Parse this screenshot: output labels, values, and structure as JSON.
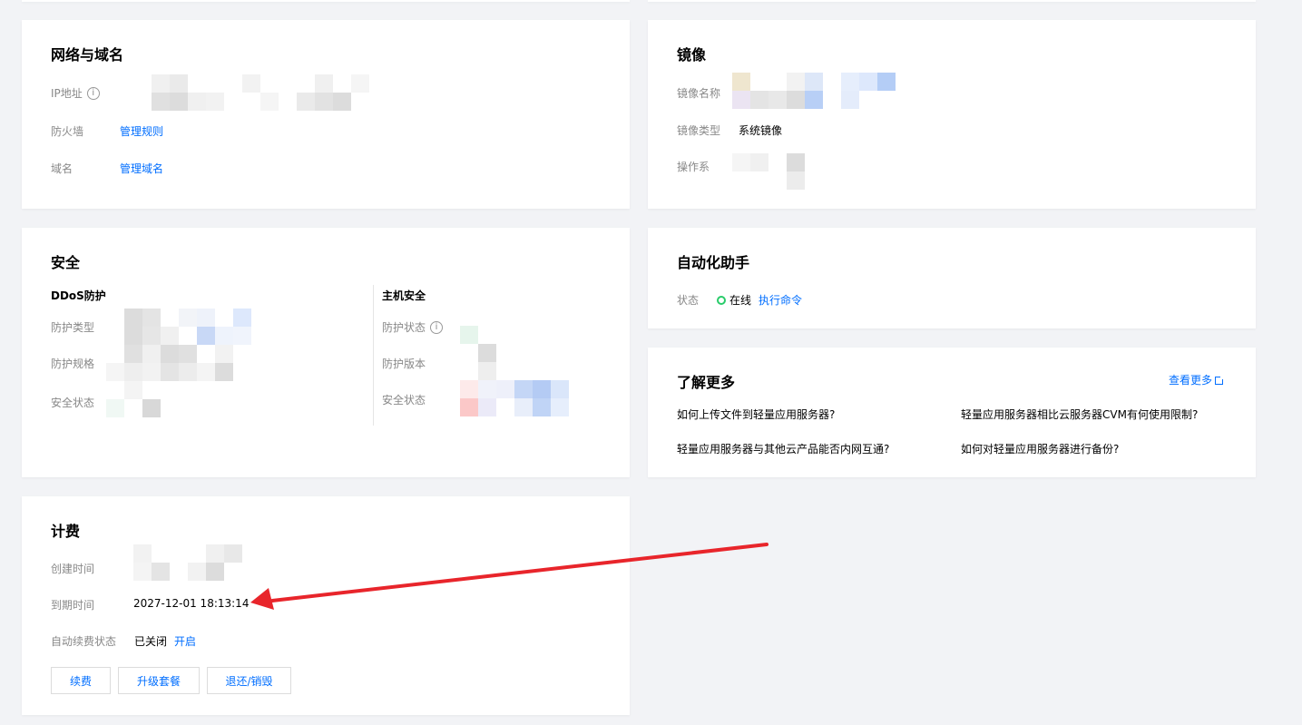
{
  "network": {
    "title": "网络与域名",
    "ip_label": "IP地址",
    "firewall_label": "防火墙",
    "firewall_link": "管理规则",
    "domain_label": "域名",
    "domain_link": "管理域名"
  },
  "image": {
    "title": "镜像",
    "name_label": "镜像名称",
    "type_label": "镜像类型",
    "type_value": "系统镜像",
    "os_label": "操作系"
  },
  "security": {
    "title": "安全",
    "ddos_title": "DDoS防护",
    "ddos_type_label": "防护类型",
    "ddos_spec_label": "防护规格",
    "ddos_status_label": "安全状态",
    "host_title": "主机安全",
    "host_status_label": "防护状态",
    "host_version_label": "防护版本",
    "host_safety_label": "安全状态"
  },
  "automation": {
    "title": "自动化助手",
    "status_label": "状态",
    "status_value": "在线",
    "command_link": "执行命令"
  },
  "learn": {
    "title": "了解更多",
    "more_link": "查看更多",
    "faqs": [
      "如何上传文件到轻量应用服务器?",
      "轻量应用服务器相比云服务器CVM有何使用限制?",
      "轻量应用服务器与其他云产品能否内网互通?",
      "如何对轻量应用服务器进行备份?"
    ]
  },
  "billing": {
    "title": "计费",
    "created_label": "创建时间",
    "expiry_label": "到期时间",
    "expiry_value": "2027-12-01 18:13:14",
    "autorenew_label": "自动续费状态",
    "autorenew_value": "已关闭",
    "autorenew_link": "开启",
    "buttons": {
      "renew": "续费",
      "upgrade": "升级套餐",
      "refund": "退还/销毁"
    }
  },
  "colors": {
    "link": "#006eff",
    "online": "#29cc6a",
    "arrow": "#e8252b"
  },
  "icons": {
    "info": "info-icon",
    "external": "external-link-icon",
    "status": "status-dot-icon"
  }
}
